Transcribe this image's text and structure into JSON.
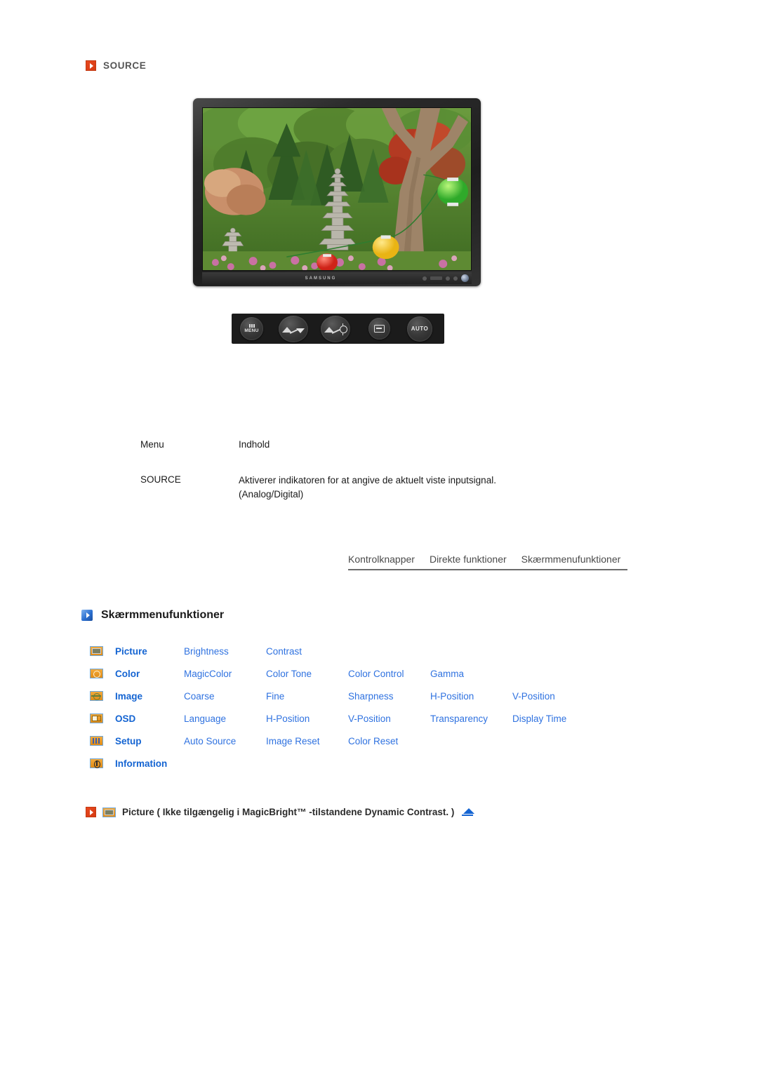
{
  "source_section": {
    "heading": "SOURCE",
    "bullet_icon": "red-triangle-bullet-icon",
    "monitor": {
      "brand_logo": "SAMSUNG",
      "screen_content": "garden-photo-with-stone-pagoda"
    },
    "control_buttons": [
      {
        "name": "menu-button",
        "label": "MENU",
        "icon": "menu-bars-icon"
      },
      {
        "name": "down-adjust-button",
        "label": "",
        "icon": "mountain-down-arrow-icon"
      },
      {
        "name": "brightness-button",
        "label": "",
        "icon": "mountain-sun-icon"
      },
      {
        "name": "enter-button",
        "label": "",
        "icon": "enter-icon"
      },
      {
        "name": "auto-button",
        "label": "AUTO",
        "icon": "auto-text-icon"
      }
    ]
  },
  "menu_table": {
    "headers": {
      "menu": "Menu",
      "content": "Indhold"
    },
    "rows": [
      {
        "menu": "SOURCE",
        "content_line1": "Aktiverer indikatoren for at angive de aktuelt viste inputsignal.",
        "content_line2": "(Analog/Digital)"
      }
    ]
  },
  "tabbar": {
    "tabs": [
      {
        "label": "Kontrolknapper"
      },
      {
        "label": "Direkte funktioner"
      },
      {
        "label": "Skærmmenufunktioner"
      }
    ]
  },
  "osd_section": {
    "heading": "Skærmmenufunktioner",
    "bullet_icon": "blue-triangle-bullet-icon",
    "rows": [
      {
        "icon": "picture-icon",
        "category": "Picture",
        "items": [
          "Brightness",
          "Contrast"
        ]
      },
      {
        "icon": "color-icon",
        "category": "Color",
        "items": [
          "MagicColor",
          "Color Tone",
          "Color Control",
          "Gamma"
        ]
      },
      {
        "icon": "image-icon",
        "category": "Image",
        "items": [
          "Coarse",
          "Fine",
          "Sharpness",
          "H-Position",
          "V-Position"
        ]
      },
      {
        "icon": "osd-icon",
        "category": "OSD",
        "items": [
          "Language",
          "H-Position",
          "V-Position",
          "Transparency",
          "Display Time"
        ]
      },
      {
        "icon": "setup-icon",
        "category": "Setup",
        "items": [
          "Auto Source",
          "Image Reset",
          "Color Reset"
        ]
      },
      {
        "icon": "information-icon",
        "category": "Information",
        "items": []
      }
    ]
  },
  "picture_line": {
    "bullet_icon": "red-triangle-bullet-icon",
    "category_icon": "picture-icon",
    "text": "Picture ( Ikke tilgængelig i MagicBright™ -tilstandene Dynamic Contrast. )",
    "back_to_top_icon": "blue-up-triangle-icon"
  },
  "colors": {
    "accent_red": "#e8481f",
    "accent_blue": "#1464d2",
    "link_blue": "#2f72e0",
    "icon_orange": "#e08c18",
    "icon_border_blue": "#6fa8dc",
    "text_dark": "#1a1a1a",
    "text_gray": "#555555"
  }
}
